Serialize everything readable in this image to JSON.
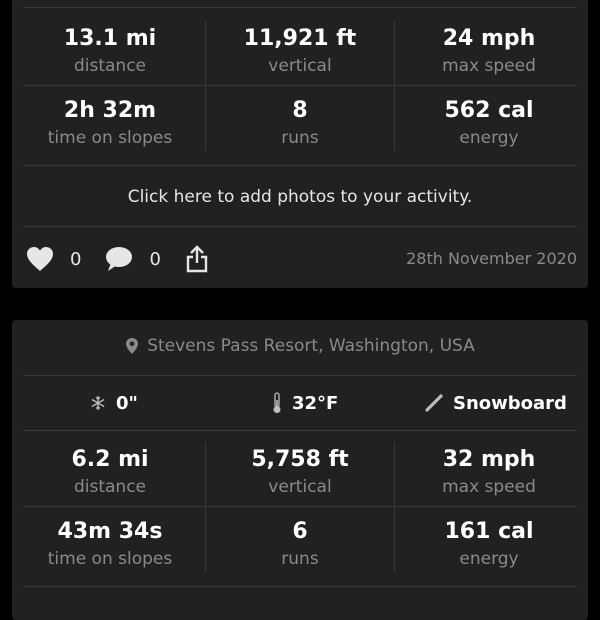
{
  "activities": [
    {
      "stats": [
        {
          "value": "13.1 mi",
          "label": "distance"
        },
        {
          "value": "11,921 ft",
          "label": "vertical"
        },
        {
          "value": "24 mph",
          "label": "max speed"
        },
        {
          "value": "2h 32m",
          "label": "time on slopes"
        },
        {
          "value": "8",
          "label": "runs"
        },
        {
          "value": "562 cal",
          "label": "energy"
        }
      ],
      "add_photos": "Click here to add photos to your activity.",
      "likes": "0",
      "comments": "0",
      "date": "28th November 2020"
    },
    {
      "location": "Stevens Pass Resort, Washington, USA",
      "conditions": {
        "snow": "0\"",
        "temperature": "32°F",
        "sport": "Snowboard"
      },
      "stats": [
        {
          "value": "6.2 mi",
          "label": "distance"
        },
        {
          "value": "5,758 ft",
          "label": "vertical"
        },
        {
          "value": "32 mph",
          "label": "max speed"
        },
        {
          "value": "43m 34s",
          "label": "time on slopes"
        },
        {
          "value": "6",
          "label": "runs"
        },
        {
          "value": "161 cal",
          "label": "energy"
        }
      ]
    }
  ],
  "icons": {
    "like": "heart-icon",
    "comment": "speech-bubble-icon",
    "share": "share-icon",
    "location": "map-pin-icon",
    "snow": "snowflake-icon",
    "temperature": "thermometer-icon",
    "sport": "snowboard-icon"
  },
  "colors": {
    "background": "#000000",
    "card": "#212121",
    "divider": "#3a3a3a",
    "muted_text": "#8a8a8a",
    "primary_text": "#ffffff"
  }
}
